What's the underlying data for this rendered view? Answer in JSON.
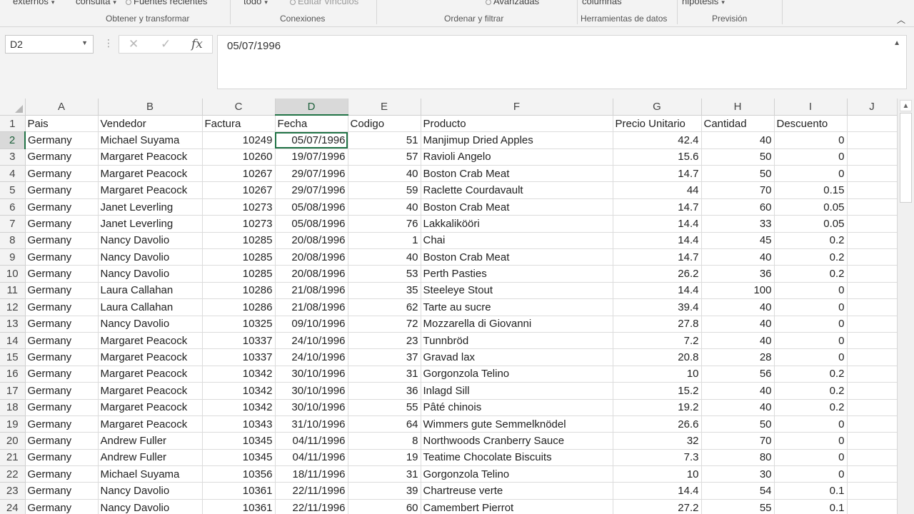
{
  "ribbon": {
    "items": [
      {
        "label": "externos",
        "caret": "▾",
        "faded": false
      },
      {
        "label": "consulta",
        "caret": "▾",
        "faded": false
      },
      {
        "label": "Fuentes recientes",
        "caret": "",
        "faded": false
      },
      {
        "label": "todo",
        "caret": "▾",
        "faded": false
      },
      {
        "label": "Editar vínculos",
        "caret": "",
        "faded": true
      },
      {
        "label": "Avanzadas",
        "caret": "",
        "faded": false
      },
      {
        "label": "columnas",
        "caret": "",
        "faded": false
      },
      {
        "label": "hipótesis",
        "caret": "▾",
        "faded": false
      }
    ],
    "groups": [
      "Obtener y transformar",
      "Conexiones",
      "Ordenar y filtrar",
      "Herramientas de datos",
      "Previsión"
    ],
    "collapse_icon": "chevron-up-icon"
  },
  "formula_bar": {
    "name_box": "D2",
    "value": "05/07/1996",
    "cancel_icon": "✕",
    "enter_icon": "✓",
    "fx_icon": "fx"
  },
  "columns": [
    "A",
    "B",
    "C",
    "D",
    "E",
    "F",
    "G",
    "H",
    "I",
    "J"
  ],
  "active_column": "D",
  "active_row": 2,
  "headers": [
    "Pais",
    "Vendedor",
    "Factura",
    "Fecha",
    "Codigo",
    "Producto",
    "Precio Unitario",
    "Cantidad",
    "Descuento"
  ],
  "rows": [
    [
      "Germany",
      "Michael Suyama",
      "10249",
      "05/07/1996",
      "51",
      "Manjimup Dried Apples",
      "42.4",
      "40",
      "0"
    ],
    [
      "Germany",
      "Margaret Peacock",
      "10260",
      "19/07/1996",
      "57",
      "Ravioli Angelo",
      "15.6",
      "50",
      "0"
    ],
    [
      "Germany",
      "Margaret Peacock",
      "10267",
      "29/07/1996",
      "40",
      "Boston Crab Meat",
      "14.7",
      "50",
      "0"
    ],
    [
      "Germany",
      "Margaret Peacock",
      "10267",
      "29/07/1996",
      "59",
      "Raclette Courdavault",
      "44",
      "70",
      "0.15"
    ],
    [
      "Germany",
      "Janet Leverling",
      "10273",
      "05/08/1996",
      "40",
      "Boston Crab Meat",
      "14.7",
      "60",
      "0.05"
    ],
    [
      "Germany",
      "Janet Leverling",
      "10273",
      "05/08/1996",
      "76",
      "Lakkalikööri",
      "14.4",
      "33",
      "0.05"
    ],
    [
      "Germany",
      "Nancy Davolio",
      "10285",
      "20/08/1996",
      "1",
      "Chai",
      "14.4",
      "45",
      "0.2"
    ],
    [
      "Germany",
      "Nancy Davolio",
      "10285",
      "20/08/1996",
      "40",
      "Boston Crab Meat",
      "14.7",
      "40",
      "0.2"
    ],
    [
      "Germany",
      "Nancy Davolio",
      "10285",
      "20/08/1996",
      "53",
      "Perth Pasties",
      "26.2",
      "36",
      "0.2"
    ],
    [
      "Germany",
      "Laura Callahan",
      "10286",
      "21/08/1996",
      "35",
      "Steeleye Stout",
      "14.4",
      "100",
      "0"
    ],
    [
      "Germany",
      "Laura Callahan",
      "10286",
      "21/08/1996",
      "62",
      "Tarte au sucre",
      "39.4",
      "40",
      "0"
    ],
    [
      "Germany",
      "Nancy Davolio",
      "10325",
      "09/10/1996",
      "72",
      "Mozzarella di Giovanni",
      "27.8",
      "40",
      "0"
    ],
    [
      "Germany",
      "Margaret Peacock",
      "10337",
      "24/10/1996",
      "23",
      "Tunnbröd",
      "7.2",
      "40",
      "0"
    ],
    [
      "Germany",
      "Margaret Peacock",
      "10337",
      "24/10/1996",
      "37",
      "Gravad lax",
      "20.8",
      "28",
      "0"
    ],
    [
      "Germany",
      "Margaret Peacock",
      "10342",
      "30/10/1996",
      "31",
      "Gorgonzola Telino",
      "10",
      "56",
      "0.2"
    ],
    [
      "Germany",
      "Margaret Peacock",
      "10342",
      "30/10/1996",
      "36",
      "Inlagd Sill",
      "15.2",
      "40",
      "0.2"
    ],
    [
      "Germany",
      "Margaret Peacock",
      "10342",
      "30/10/1996",
      "55",
      "Pâté chinois",
      "19.2",
      "40",
      "0.2"
    ],
    [
      "Germany",
      "Margaret Peacock",
      "10343",
      "31/10/1996",
      "64",
      "Wimmers gute Semmelknödel",
      "26.6",
      "50",
      "0"
    ],
    [
      "Germany",
      "Andrew Fuller",
      "10345",
      "04/11/1996",
      "8",
      "Northwoods Cranberry Sauce",
      "32",
      "70",
      "0"
    ],
    [
      "Germany",
      "Andrew Fuller",
      "10345",
      "04/11/1996",
      "19",
      "Teatime Chocolate Biscuits",
      "7.3",
      "80",
      "0"
    ],
    [
      "Germany",
      "Michael Suyama",
      "10356",
      "18/11/1996",
      "31",
      "Gorgonzola Telino",
      "10",
      "30",
      "0"
    ],
    [
      "Germany",
      "Nancy Davolio",
      "10361",
      "22/11/1996",
      "39",
      "Chartreuse verte",
      "14.4",
      "54",
      "0.1"
    ],
    [
      "Germany",
      "Nancy Davolio",
      "10361",
      "22/11/1996",
      "60",
      "Camembert Pierrot",
      "27.2",
      "55",
      "0.1"
    ]
  ],
  "numeric_columns": [
    "C",
    "D",
    "E",
    "G",
    "H",
    "I"
  ],
  "colors": {
    "accent": "#217346",
    "header_bg": "#f3f3f3",
    "gridline": "#dcdcdc"
  }
}
